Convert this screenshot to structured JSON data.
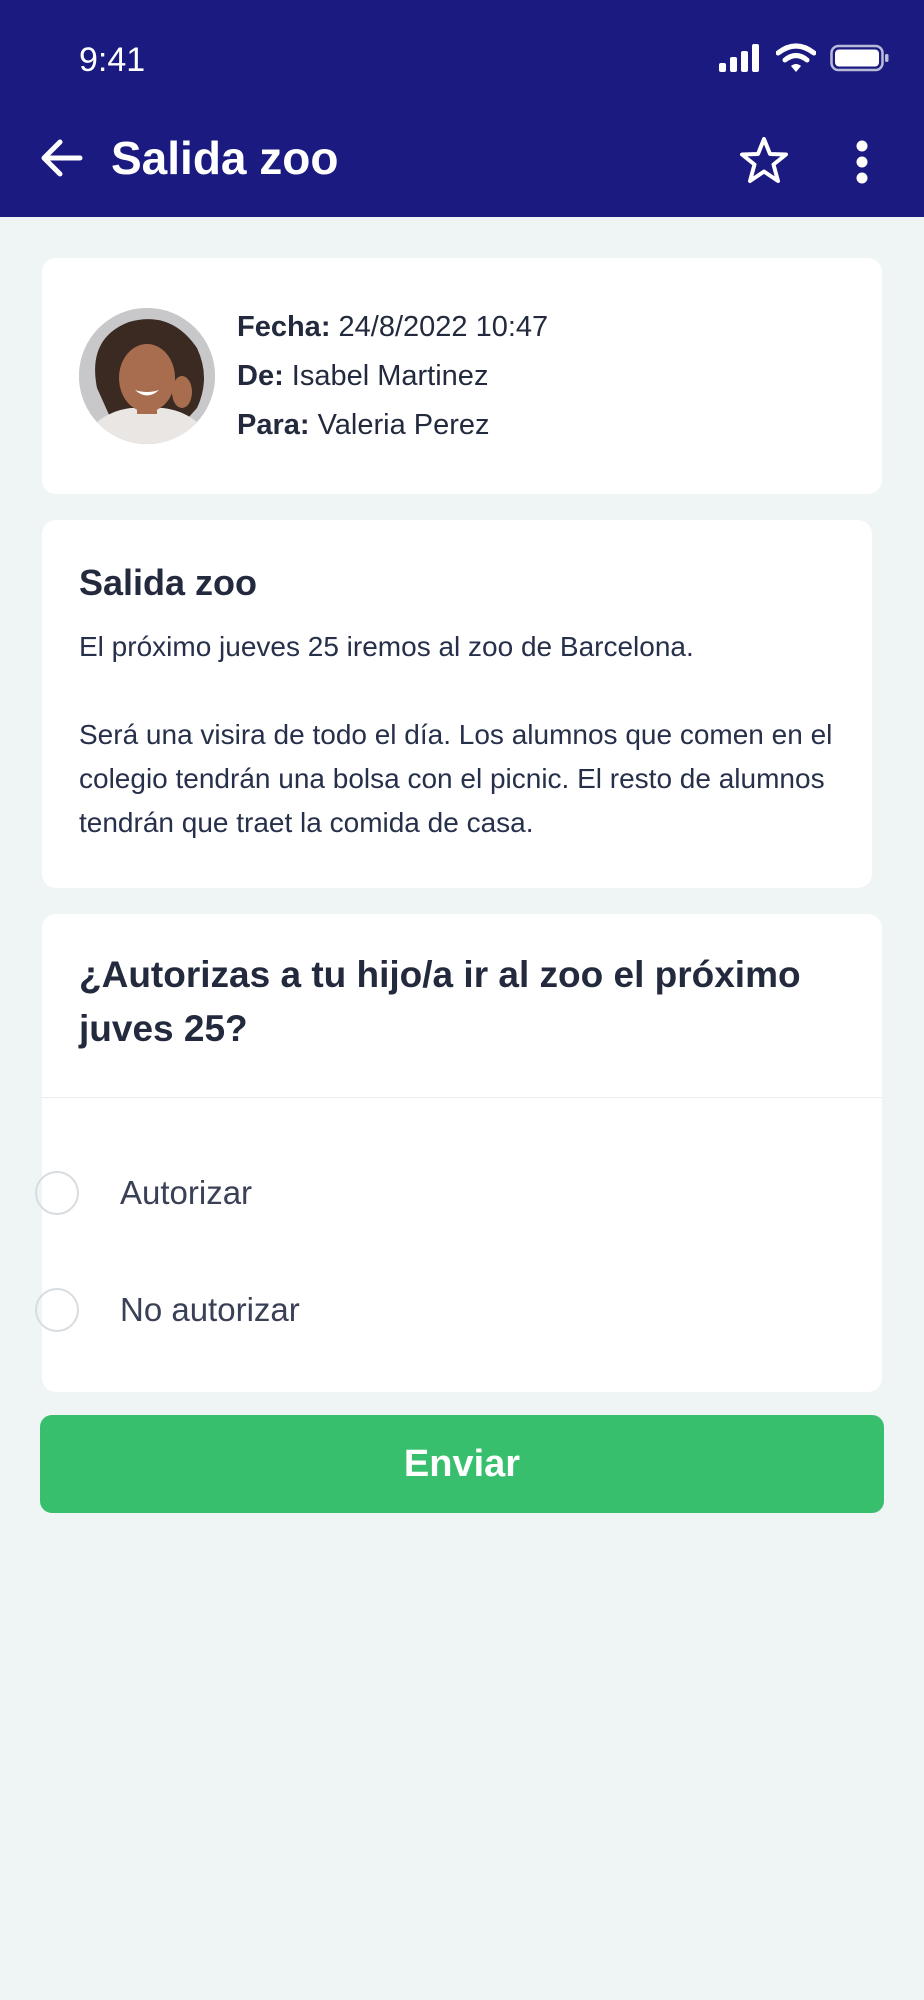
{
  "status_bar": {
    "time": "9:41"
  },
  "header": {
    "title": "Salida zoo"
  },
  "message_meta": {
    "date_label": "Fecha:",
    "date_value": "24/8/2022 10:47",
    "from_label": "De:",
    "from_value": "Isabel Martinez",
    "to_label": "Para:",
    "to_value": "Valeria Perez"
  },
  "message": {
    "title": "Salida zoo",
    "paragraphs": [
      "El próximo jueves 25 iremos al zoo de Barcelona.",
      "Será una visira de todo el día. Los alumnos que comen en el colegio tendrán una bolsa con el picnic. El resto de alumnos tendrán que traet la comida de casa."
    ]
  },
  "question": {
    "text": "¿Autorizas a tu hijo/a ir al zoo el próximo juves 25?",
    "options": [
      {
        "label": "Autorizar",
        "selected": false
      },
      {
        "label": "No autorizar",
        "selected": false
      }
    ]
  },
  "submit": {
    "label": "Enviar"
  },
  "colors": {
    "header_bg": "#1a1a80",
    "page_bg": "#eff4f4",
    "accent_green": "#37bf6e",
    "text_dark": "#232a3d"
  },
  "icons": {
    "back": "arrow-left-icon",
    "favorite": "star-outline-icon",
    "more": "more-vertical-icon",
    "signal": "cellular-signal-icon",
    "wifi": "wifi-icon",
    "battery": "battery-icon"
  }
}
